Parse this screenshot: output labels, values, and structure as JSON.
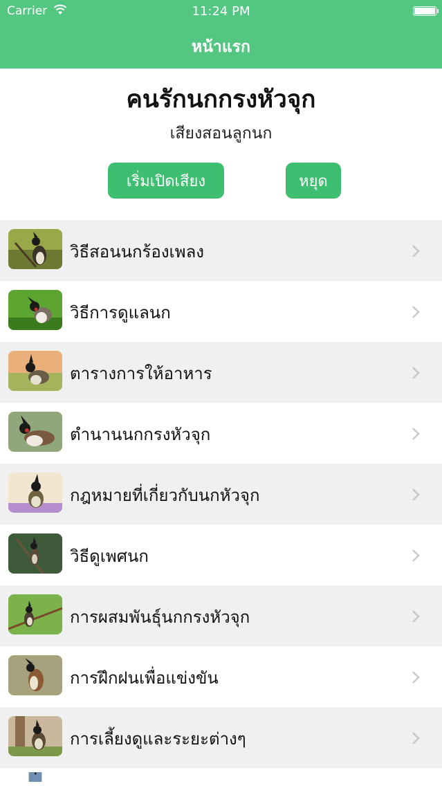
{
  "status_bar": {
    "carrier": "Carrier",
    "time": "11:24 PM"
  },
  "nav": {
    "title": "หน้าแรก"
  },
  "header": {
    "title": "คนรักนกกรงหัวจุก",
    "subtitle": "เสียงสอนลูกนก"
  },
  "buttons": {
    "play_label": "เริ่มเปิดเสียง",
    "stop_label": "หยุด"
  },
  "list": {
    "items": [
      {
        "label": "วิธีสอนนกร้องเพลง"
      },
      {
        "label": "วิธีการดูแลนก"
      },
      {
        "label": "ตารางการให้อาหาร"
      },
      {
        "label": "ตำนานนกกรงหัวจุก"
      },
      {
        "label": "กฎหมายที่เกี่ยวกับนกหัวจุก"
      },
      {
        "label": "วิธีดูเพศนก"
      },
      {
        "label": "การผสมพันธุ์นกกรงหัวจุก"
      },
      {
        "label": "การฝึกฝนเพื่อแข่งขัน"
      },
      {
        "label": "การเลี้ยงดูและระยะต่างๆ"
      }
    ]
  },
  "colors": {
    "header_green": "#53c681",
    "button_green": "#3dbe70",
    "row_grey": "#f0f0f0",
    "chevron": "#c7c7cc"
  }
}
